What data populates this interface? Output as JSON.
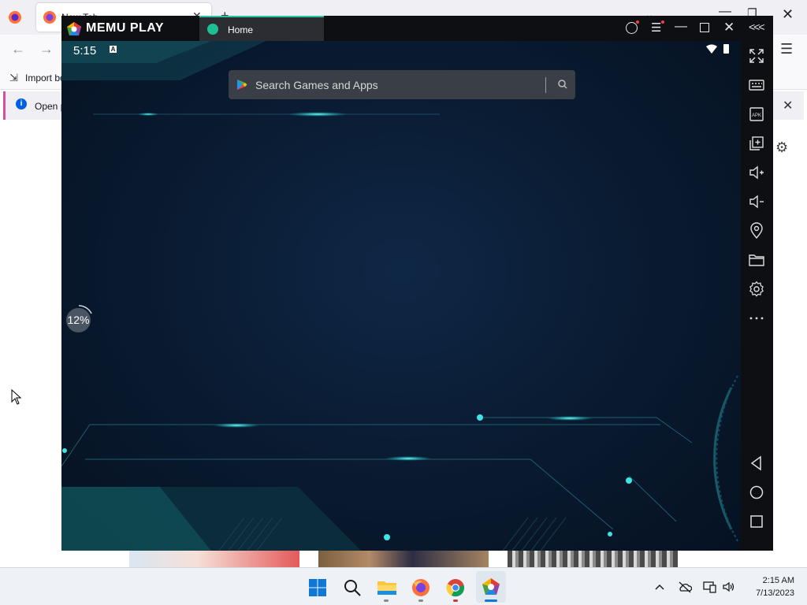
{
  "firefox": {
    "tab_title": "New Tab",
    "tab_close": "✕",
    "new_tab": "+",
    "list_tabs": "⌄",
    "window_minimize": "—",
    "window_maximize": "❐",
    "window_close": "✕",
    "back": "←",
    "forward": "→",
    "menu": "☰",
    "bookmark_import_label": "Import bookmarks...",
    "notice_text": "Open previous windows and tabs?",
    "notice_close": "✕",
    "settings_glyph": "⚙"
  },
  "memu": {
    "brand": "MEMU PLAY",
    "tab_label": "Home",
    "title_controls": {
      "menu": "☰",
      "minimize": "—",
      "close": "✕",
      "collapse": "<<<"
    },
    "statusbar": {
      "time": "5:15",
      "notification_badge": "A"
    },
    "search": {
      "placeholder": "Search Games and Apps"
    },
    "loading_percent": "12%",
    "sidebar_icons": [
      "fullscreen-icon",
      "keyboard-mapping-icon",
      "apk-install-icon",
      "multi-instance-icon",
      "volume-up-icon",
      "volume-down-icon",
      "location-icon",
      "folder-icon",
      "settings-icon",
      "more-icon",
      "android-back-icon",
      "android-home-icon",
      "android-recents-icon"
    ],
    "accent_color": "#28c4a4"
  },
  "taskbar": {
    "time": "2:15 AM",
    "date": "7/13/2023",
    "apps": [
      "start-icon",
      "search-icon",
      "file-explorer-icon",
      "firefox-icon",
      "chrome-icon",
      "memu-icon"
    ],
    "tray": [
      "chevron-up-icon",
      "onedrive-icon",
      "network-icon",
      "volume-icon"
    ]
  }
}
